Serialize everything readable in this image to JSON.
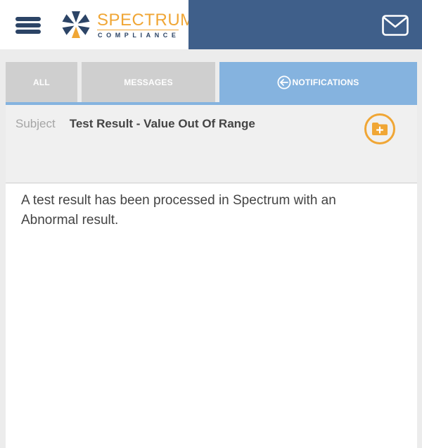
{
  "header": {
    "logo": {
      "title": "SPECTRUM",
      "subtitle": "COMPLIANCE"
    },
    "menu_icon": "hamburger-menu-icon",
    "mail_icon": "mail-icon",
    "colors": {
      "left_bg": "#ffffff",
      "right_bg": "#3f5f8a",
      "logo_orange": "#f0a635",
      "logo_navy": "#2c4466"
    }
  },
  "tabs": [
    {
      "label": "ALL",
      "active": false
    },
    {
      "label": "MESSAGES",
      "active": false
    },
    {
      "label": "NOTIFICATIONS",
      "active": true,
      "icon": "arrow-left-circle-icon"
    }
  ],
  "notification": {
    "subject_label": "Subject",
    "subject_value": "Test Result - Value Out Of Range",
    "action_icon": "add-folder-icon",
    "body": "A test result has been processed in Spectrum with an Abnormal result."
  },
  "colors": {
    "tab_inactive": "#cfcfcf",
    "tab_active": "#85b3df",
    "accent": "#f0a635"
  }
}
